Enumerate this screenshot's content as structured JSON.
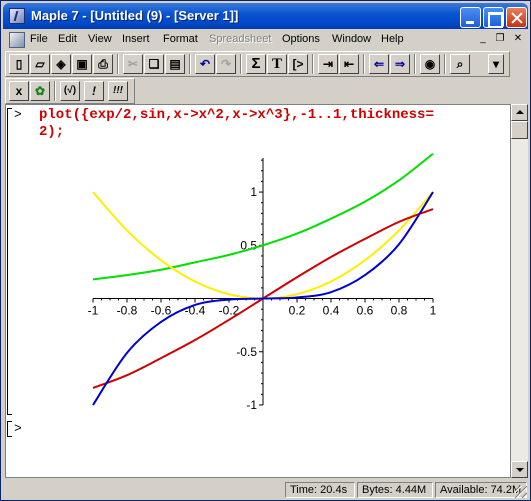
{
  "window": {
    "title": "Maple 7  - [Untitled (9) - [Server 1]]"
  },
  "menu": {
    "items": [
      "File",
      "Edit",
      "View",
      "Insert",
      "Format",
      "Spreadsheet",
      "Options",
      "Window",
      "Help"
    ],
    "disabled": [
      "Spreadsheet"
    ]
  },
  "toolbar1": {
    "buttons": [
      {
        "name": "new",
        "icon": "new-document-icon"
      },
      {
        "name": "open",
        "icon": "open-folder-icon"
      },
      {
        "name": "open-url",
        "icon": "open-url-icon"
      },
      {
        "name": "save",
        "icon": "save-disk-icon"
      },
      {
        "name": "print",
        "icon": "printer-icon"
      },
      {
        "name": "cut",
        "icon": "scissors-icon"
      },
      {
        "name": "copy",
        "icon": "copy-icon"
      },
      {
        "name": "paste",
        "icon": "paste-icon"
      },
      {
        "name": "undo",
        "icon": "undo-arrow-icon"
      },
      {
        "name": "redo",
        "icon": "redo-arrow-icon"
      },
      {
        "name": "sum",
        "icon": "sigma-icon"
      },
      {
        "name": "text",
        "icon": "text-T-icon"
      },
      {
        "name": "input",
        "icon": "input-prompt-icon"
      },
      {
        "name": "indent",
        "icon": "indent-icon"
      },
      {
        "name": "outdent",
        "icon": "outdent-icon"
      },
      {
        "name": "back",
        "icon": "back-arrow-icon"
      },
      {
        "name": "forward",
        "icon": "forward-arrow-icon"
      },
      {
        "name": "stop",
        "icon": "stop-icon"
      },
      {
        "name": "zoom",
        "icon": "zoom-magnifier-icon"
      }
    ]
  },
  "toolbar2": {
    "buttons": [
      {
        "name": "interrupt",
        "icon": "interrupt-x-icon",
        "label": "x"
      },
      {
        "name": "restart",
        "icon": "maple-leaf-icon",
        "label": "✿"
      },
      {
        "name": "execute",
        "icon": "execute-check-icon",
        "label": "(√)"
      },
      {
        "name": "execute-one",
        "icon": "execute-one-icon",
        "label": "!"
      },
      {
        "name": "execute-all",
        "icon": "execute-all-icon",
        "label": "!!!"
      }
    ]
  },
  "worksheet": {
    "prompt": ">",
    "command_line1": "plot({exp/2,sin,x->x^2,x->x^3},-1..1,thickness=",
    "command_line2": "2);",
    "empty_prompt": ">"
  },
  "colors": {
    "command": "#d00000",
    "series": [
      "#00e000",
      "#ffee00",
      "#d00000",
      "#0000d0"
    ]
  },
  "chart_data": {
    "type": "line",
    "xlim": [
      -1,
      1
    ],
    "ylim": [
      -1,
      1.32
    ],
    "xticks": [
      -1,
      -0.8,
      -0.6,
      -0.4,
      -0.2,
      0.2,
      0.4,
      0.6,
      0.8,
      1
    ],
    "xtick_labels": [
      "-1",
      "-0.8",
      "-0.6",
      "-0.4",
      "-0.2",
      "0.2",
      "0.4",
      "0.6",
      "0.8",
      "1"
    ],
    "yticks": [
      -1,
      -0.5,
      0.5,
      1
    ],
    "ytick_labels": [
      "-1",
      "-0.5",
      "0.5",
      "1"
    ],
    "series": [
      {
        "color": "#00e000",
        "x": [
          -1,
          -0.8,
          -0.6,
          -0.4,
          -0.2,
          0,
          0.2,
          0.4,
          0.6,
          0.8,
          1
        ],
        "y": [
          0.18,
          0.22,
          0.27,
          0.34,
          0.41,
          0.5,
          0.61,
          0.75,
          0.91,
          1.11,
          1.36
        ]
      },
      {
        "color": "#ffee00",
        "x": [
          -1,
          -0.8,
          -0.6,
          -0.4,
          -0.2,
          0,
          0.2,
          0.4,
          0.6,
          0.8,
          1
        ],
        "y": [
          1,
          0.64,
          0.36,
          0.16,
          0.04,
          0,
          0.04,
          0.16,
          0.36,
          0.64,
          1
        ]
      },
      {
        "color": "#d00000",
        "x": [
          -1,
          -0.8,
          -0.6,
          -0.4,
          -0.2,
          0,
          0.2,
          0.4,
          0.6,
          0.8,
          1
        ],
        "y": [
          -0.84,
          -0.72,
          -0.56,
          -0.39,
          -0.2,
          0,
          0.2,
          0.39,
          0.56,
          0.72,
          0.84
        ]
      },
      {
        "color": "#0000d0",
        "x": [
          -1,
          -0.8,
          -0.6,
          -0.4,
          -0.2,
          0,
          0.2,
          0.4,
          0.6,
          0.8,
          1
        ],
        "y": [
          -1,
          -0.51,
          -0.22,
          -0.06,
          -0.01,
          0,
          0.01,
          0.06,
          0.22,
          0.51,
          1
        ]
      }
    ]
  },
  "status": {
    "time_label": "Time:",
    "time": "20.4s",
    "bytes_label": "Bytes:",
    "bytes": "4.44M",
    "available_label": "Available:",
    "available": "74.2M"
  }
}
